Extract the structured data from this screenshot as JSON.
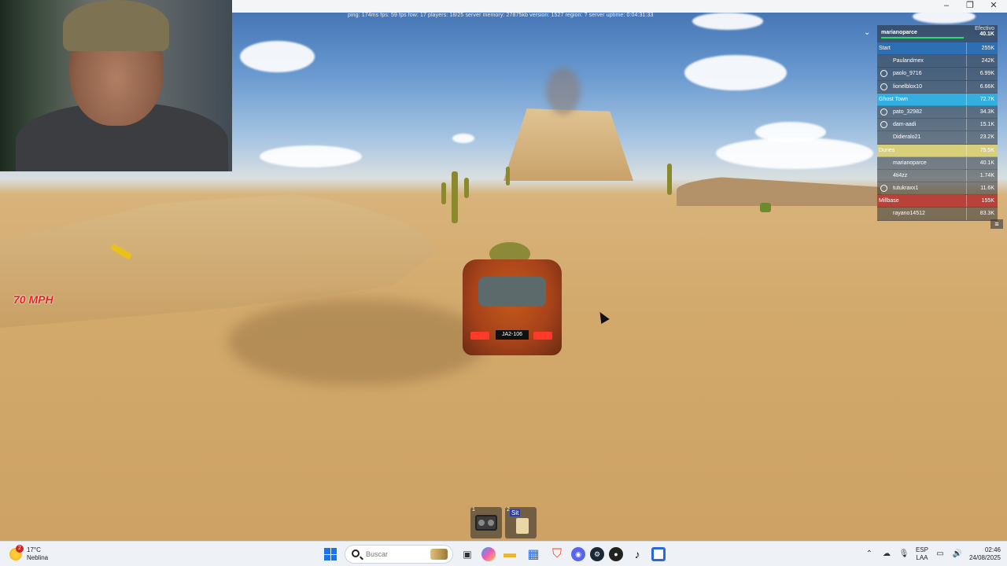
{
  "window": {
    "minimize": "–",
    "restore": "❐",
    "close": "✕"
  },
  "game": {
    "stats_line": "ping: 174ms fps: 59 fps fow: 17 players: 18/25 server memory: 27875kb version: 1527 region: ? server uptime: 0:04:31:33",
    "speed": "70 MPH",
    "car_plate": "JA2-106"
  },
  "leaderboard": {
    "player": "marianoparce",
    "column_label": "Efectivo",
    "player_value": "40.1K",
    "rows": [
      {
        "type": "team",
        "name": "Start",
        "value": "255K",
        "color": "#2c6fb4"
      },
      {
        "type": "player",
        "name": "Paulandmex",
        "value": "242K",
        "icon": false
      },
      {
        "type": "player",
        "name": "paolo_9716",
        "value": "6.99K",
        "icon": true
      },
      {
        "type": "player",
        "name": "lionelblox10",
        "value": "6.66K",
        "icon": true
      },
      {
        "type": "team",
        "name": "Ghost Town",
        "value": "72.7K",
        "color": "#33aee0"
      },
      {
        "type": "player",
        "name": "pato_32982",
        "value": "34.3K",
        "icon": true
      },
      {
        "type": "player",
        "name": "dam-aadi",
        "value": "15.1K",
        "icon": true
      },
      {
        "type": "player",
        "name": "Didieralo21",
        "value": "23.2K",
        "icon": false
      },
      {
        "type": "team",
        "name": "Dunes",
        "value": "75.5K",
        "color": "#d8cf7a"
      },
      {
        "type": "player",
        "name": "marianoparce",
        "value": "40.1K",
        "icon": false
      },
      {
        "type": "player",
        "name": "4ti4zz",
        "value": "1.74K",
        "icon": false
      },
      {
        "type": "player",
        "name": "tutukraxx1",
        "value": "11.6K",
        "icon": true
      },
      {
        "type": "team",
        "name": "Millbase",
        "value": "155K",
        "color": "#b8413a"
      },
      {
        "type": "player",
        "name": "rayano14512",
        "value": "83.3K",
        "icon": false
      }
    ],
    "menu_icon": "≡"
  },
  "hotbar": [
    {
      "num": "1",
      "icon": "radio-icon"
    },
    {
      "num": "2",
      "label": "Sit",
      "icon": "character-icon"
    }
  ],
  "taskbar": {
    "weather_temp": "17°C",
    "weather_desc": "Neblina",
    "weather_badge": "2",
    "search_placeholder": "Buscar",
    "lang_top": "ESP",
    "lang_bottom": "LAA",
    "time": "02:46",
    "date": "24/08/2025",
    "apps": [
      "task-view-icon",
      "copilot-icon",
      "file-explorer-icon",
      "store-icon",
      "brave-icon",
      "discord-icon",
      "steam-icon",
      "app-icon",
      "tiktok-icon",
      "roblox-icon"
    ]
  }
}
